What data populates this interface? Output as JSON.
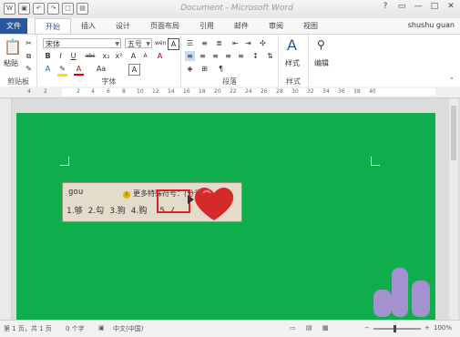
{
  "window": {
    "title": "Document - Microsoft Word",
    "qat": [
      "save-icon",
      "undo-icon",
      "redo-icon",
      "new-doc-icon",
      "open-icon"
    ],
    "controls": {
      "help": "?",
      "restore": "▭",
      "minimize": "—",
      "maximize": "□",
      "close": "✕"
    }
  },
  "tabs": {
    "file": "文件",
    "items": [
      "开始",
      "插入",
      "设计",
      "页面布局",
      "引用",
      "邮件",
      "审阅",
      "视图"
    ],
    "user": "shushu guan"
  },
  "ribbon": {
    "clipboard": {
      "paste_label": "粘贴",
      "group_label": "剪贴板"
    },
    "font": {
      "font_name": "宋体",
      "font_size": "五号",
      "wen_label": "wén",
      "group_label": "字体",
      "bold": "B",
      "italic": "I",
      "underline": "U",
      "strike": "abc",
      "sub": "x₂",
      "sup": "x²",
      "aa": "Aa",
      "grow": "A",
      "shrink": "A",
      "a_label": "A",
      "clear": "A"
    },
    "paragraph": {
      "group_label": "段落"
    },
    "styles": {
      "styles_label": "样式",
      "group_label": "样式"
    },
    "editing": {
      "editing_label": "编辑"
    }
  },
  "ruler": {
    "numbers": [
      "4",
      "2",
      "2",
      "4",
      "6",
      "8",
      "10",
      "12",
      "14",
      "16",
      "18",
      "20",
      "22",
      "24",
      "26",
      "28",
      "30",
      "32",
      "34",
      "36",
      "38",
      "40"
    ]
  },
  "ime": {
    "composition": "gou",
    "tip": "更多特殊符号：(分号+",
    "candidates": [
      "1.够",
      "2.勾",
      "3.狗",
      "4.购",
      "5.ノ"
    ]
  },
  "status": {
    "page": "第 1 页，共 1 页",
    "words": "0 个字",
    "language": "中文(中国)",
    "zoom": "100%"
  },
  "colors": {
    "page_bg": "#10ad4c",
    "file_tab": "#2b579a",
    "highlight": "#e02020",
    "heart": "#d62a2a"
  }
}
